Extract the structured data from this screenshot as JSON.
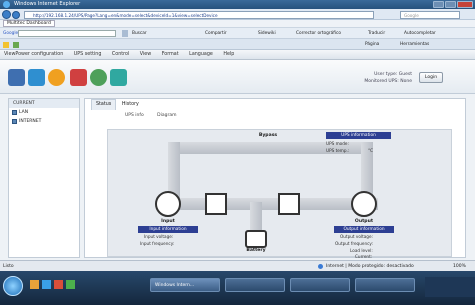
{
  "browser": {
    "title": "Windows Internet Explorer",
    "url": "http://192.168.1.24/UPS/Page?Lang=en&mode=select&deviceId=1&view=selectDevice",
    "search_placeholder": "Google",
    "tab_label": "Multitec Dashboard"
  },
  "google_bar": {
    "label": "Google",
    "items": [
      "Buscar",
      "Compartir",
      "Sidewiki",
      "Corrector ortográfico",
      "Traducir",
      "Autocompletar"
    ]
  },
  "fav_bar": {
    "right_items": [
      "Página",
      "Herramientas"
    ]
  },
  "app": {
    "menu": [
      "ViewPower configuration",
      "UPS setting",
      "Control",
      "View",
      "Format",
      "Language",
      "Help"
    ],
    "user_type_label": "User type:",
    "user_type_value": "Guest",
    "monitored_label": "Monitored UPS:",
    "monitored_value": "None",
    "login_label": "Login"
  },
  "sidebar": {
    "header": "CURRENT",
    "items": [
      {
        "label": "LAN"
      },
      {
        "label": "INTERNET"
      }
    ]
  },
  "tabs": [
    "Status",
    "History"
  ],
  "subtabs": [
    "UPS info",
    "Diagram"
  ],
  "diagram": {
    "bypass_label": "Bypass",
    "ups_info_header": "UPS information",
    "ups_mode_label": "UPS mode:",
    "ups_temp_label": "UPS temp.:",
    "ups_temp_unit": "°C",
    "input_label": "Input",
    "input_info_header": "Input information",
    "input_voltage_label": "Input voltage:",
    "input_freq_label": "Input frequency:",
    "output_label": "Output",
    "output_info_header": "Output information",
    "output_voltage_label": "Output voltage:",
    "output_freq_label": "Output frequency:",
    "load_level_label": "Load level:",
    "current_label": "Current:",
    "battery_label": "Battery",
    "battery_info_header": "Battery information"
  },
  "status_bar": {
    "left": "Listo",
    "zone": "Internet | Modo protegido: desactivado",
    "zoom": "100%"
  },
  "taskbar": {
    "items": [
      "Windows Intern..."
    ]
  }
}
